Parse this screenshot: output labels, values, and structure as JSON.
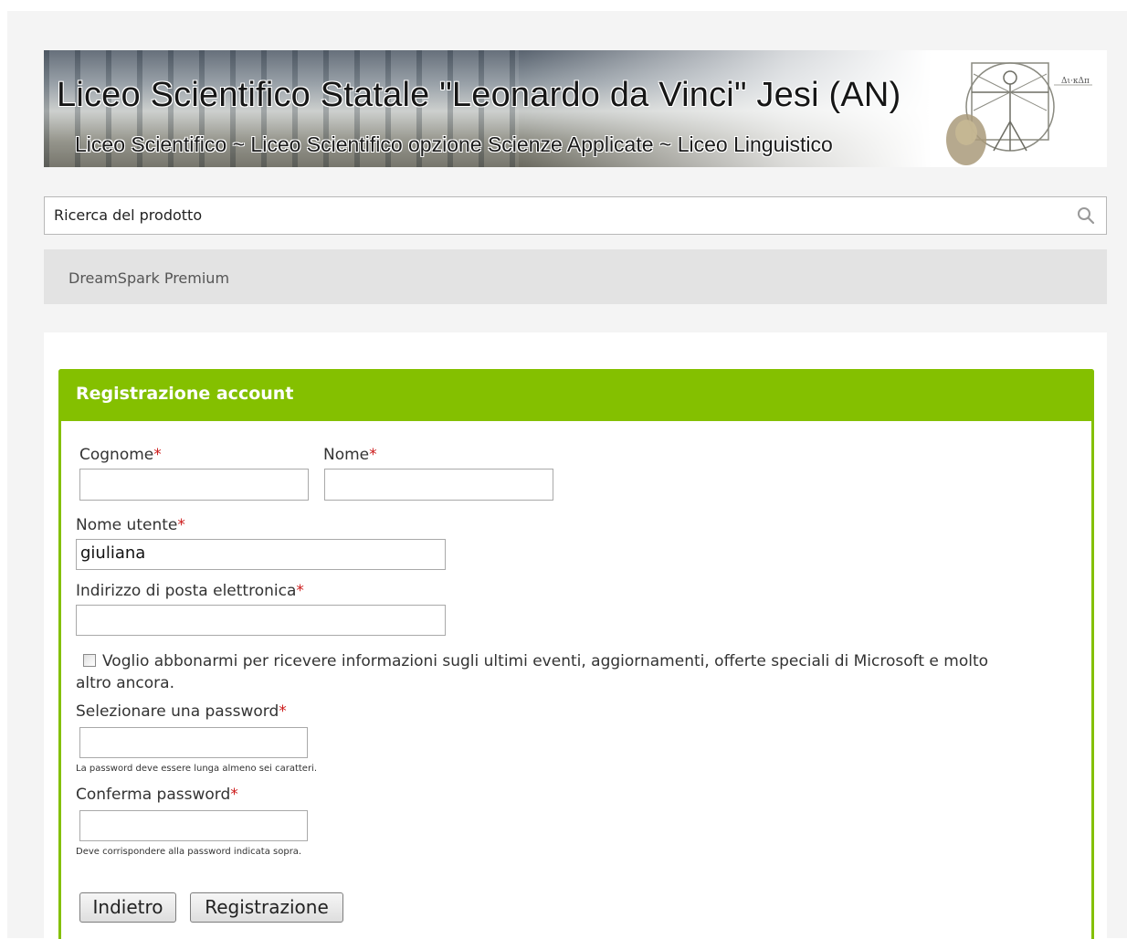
{
  "banner": {
    "title": "Liceo Scientifico Statale \"Leonardo da Vinci\" Jesi (AN)",
    "subtitle": "Liceo Scientifico ~ Liceo Scientifico opzione Scienze Applicate ~ Liceo Linguistico"
  },
  "search": {
    "placeholder": "Ricerca del prodotto",
    "icon": "search-icon"
  },
  "nav": {
    "items": [
      {
        "label": "DreamSpark Premium"
      }
    ]
  },
  "form": {
    "title": "Registrazione account",
    "required_marker": "*",
    "accent_color": "#84c000",
    "required_color": "#cc1a1a",
    "fields": {
      "cognome": {
        "label": "Cognome",
        "value": ""
      },
      "nome": {
        "label": "Nome",
        "value": ""
      },
      "nome_utente": {
        "label": "Nome utente",
        "value": "giuliana"
      },
      "email": {
        "label": "Indirizzo di posta elettronica",
        "value": ""
      },
      "password": {
        "label": "Selezionare una password",
        "value": "",
        "hint": "La password deve essere lunga almeno sei caratteri."
      },
      "conferma": {
        "label": "Conferma password",
        "value": "",
        "hint": "Deve corrispondere alla password indicata sopra."
      }
    },
    "newsletter": {
      "line1": "Voglio abbonarmi per ricevere informazioni sugli ultimi eventi, aggiornamenti, offerte speciali di Microsoft e molto",
      "line2": "altro ancora.",
      "checked": false
    },
    "buttons": {
      "back": "Indietro",
      "submit": "Registrazione"
    }
  }
}
